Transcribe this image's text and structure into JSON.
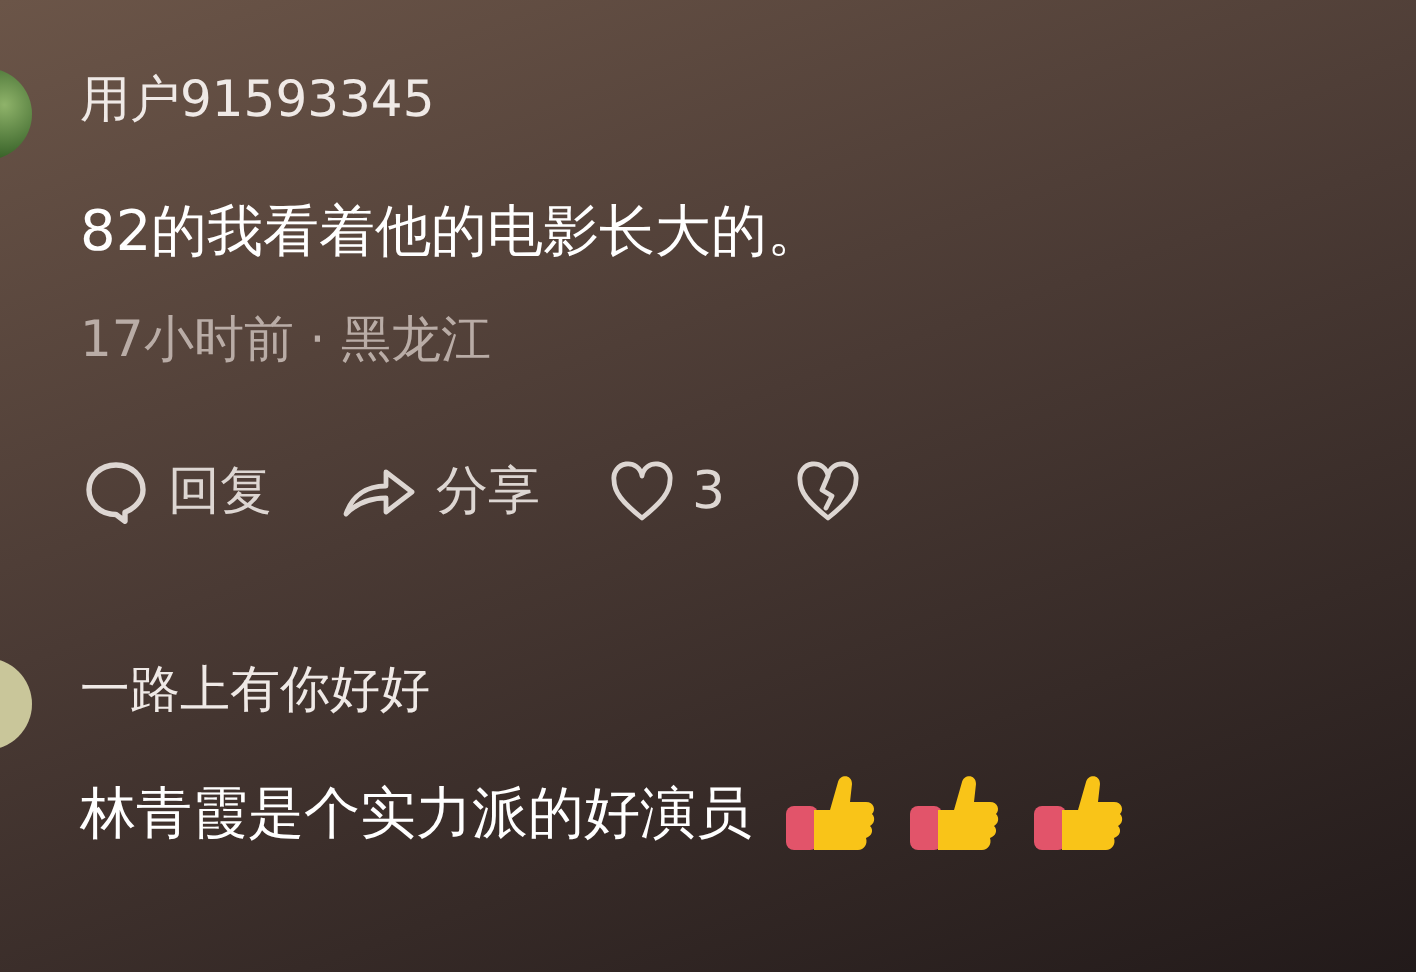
{
  "comments": [
    {
      "username": "用户91593345",
      "text": "82的我看着他的电影长大的。",
      "meta": "17小时前 · 黑龙江",
      "avatar": {
        "kind": "photo"
      },
      "actions": [
        {
          "kind": "reply",
          "label": "回复"
        },
        {
          "kind": "share",
          "label": "分享"
        },
        {
          "kind": "like",
          "label": "3"
        },
        {
          "kind": "dislike"
        }
      ]
    },
    {
      "username": "一路上有你好好",
      "text": "林青霞是个实力派的好演员",
      "avatar": {
        "kind": "plain"
      },
      "emojis": [
        {
          "kind": "thumbs-up"
        },
        {
          "kind": "thumbs-up"
        },
        {
          "kind": "thumbs-up"
        }
      ]
    }
  ]
}
